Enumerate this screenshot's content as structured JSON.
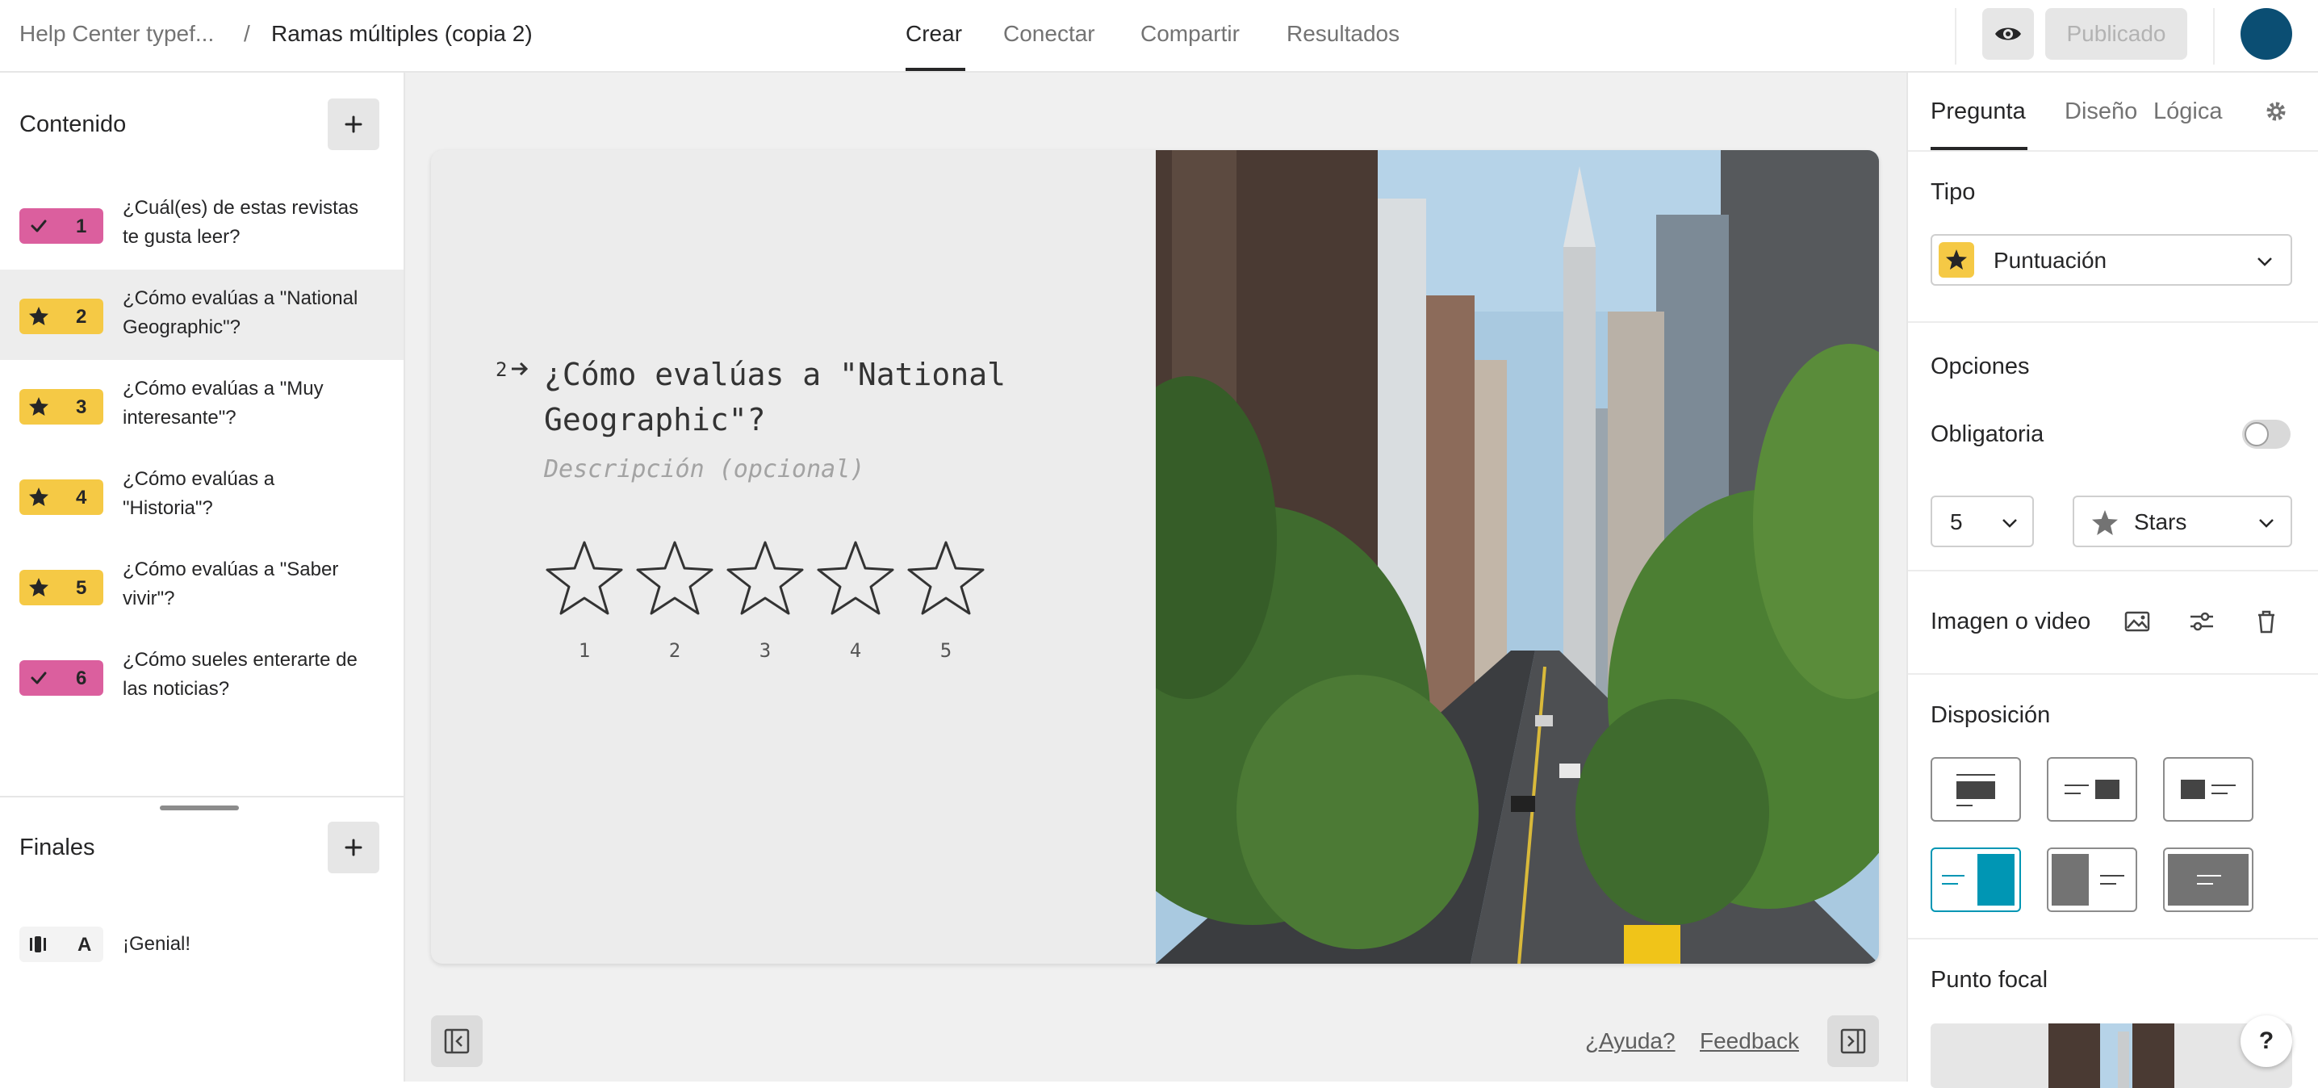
{
  "header": {
    "breadcrumb_parent": "Help Center typef...",
    "breadcrumb_sep": "/",
    "form_title": "Ramas múltiples (copia 2)",
    "tabs": [
      {
        "label": "Crear",
        "active": true
      },
      {
        "label": "Conectar",
        "active": false
      },
      {
        "label": "Compartir",
        "active": false
      },
      {
        "label": "Resultados",
        "active": false
      }
    ],
    "preview_icon": "eye-icon",
    "publish_label": "Publicado"
  },
  "sidebar": {
    "content_title": "Contenido",
    "questions": [
      {
        "number": "1",
        "type": "multiple-choice",
        "icon": "check-icon",
        "color": "#db5f9e",
        "text": "¿Cuál(es) de estas revistas te gusta leer?"
      },
      {
        "number": "2",
        "type": "rating",
        "icon": "star-icon",
        "color": "#f5c945",
        "text": "¿Cómo evalúas a \"National Geographic\"?",
        "selected": true
      },
      {
        "number": "3",
        "type": "rating",
        "icon": "star-icon",
        "color": "#f5c945",
        "text": "¿Cómo evalúas a \"Muy interesante\"?"
      },
      {
        "number": "4",
        "type": "rating",
        "icon": "star-icon",
        "color": "#f5c945",
        "text": "¿Cómo evalúas a \"Historia\"?"
      },
      {
        "number": "5",
        "type": "rating",
        "icon": "star-icon",
        "color": "#f5c945",
        "text": "¿Cómo evalúas a \"Saber vivir\"?"
      },
      {
        "number": "6",
        "type": "multiple-choice",
        "icon": "check-icon",
        "color": "#db5f9e",
        "text": "¿Cómo sueles enterarte de las noticias?"
      }
    ],
    "endings_title": "Finales",
    "endings": [
      {
        "letter": "A",
        "icon": "ending-icon",
        "text": "¡Genial!"
      }
    ]
  },
  "canvas": {
    "question_number": "2",
    "question_title": "¿Cómo evalúas a \"National Geographic\"?",
    "description_placeholder": "Descripción (opcional)",
    "rating_labels": [
      "1",
      "2",
      "3",
      "4",
      "5"
    ],
    "image_alt": "New York city street with skyscrapers and trees",
    "help_link": "¿Ayuda?",
    "feedback_link": "Feedback"
  },
  "panel": {
    "tabs": [
      {
        "label": "Pregunta",
        "active": true
      },
      {
        "label": "Diseño",
        "active": false
      },
      {
        "label": "Lógica",
        "active": false
      }
    ],
    "settings_icon": "gear-icon",
    "type_label": "Tipo",
    "type_value": "Puntuación",
    "options_label": "Opciones",
    "required_label": "Obligatoria",
    "required_on": false,
    "steps_value": "5",
    "shape_value": "Stars",
    "media_label": "Imagen o video",
    "layout_label": "Disposición",
    "focal_label": "Punto focal",
    "help_button": "?"
  },
  "colors": {
    "accent": "#0096b4",
    "rating_badge": "#f5c945",
    "choice_badge": "#db5f9e",
    "avatar": "#0b4e73"
  }
}
